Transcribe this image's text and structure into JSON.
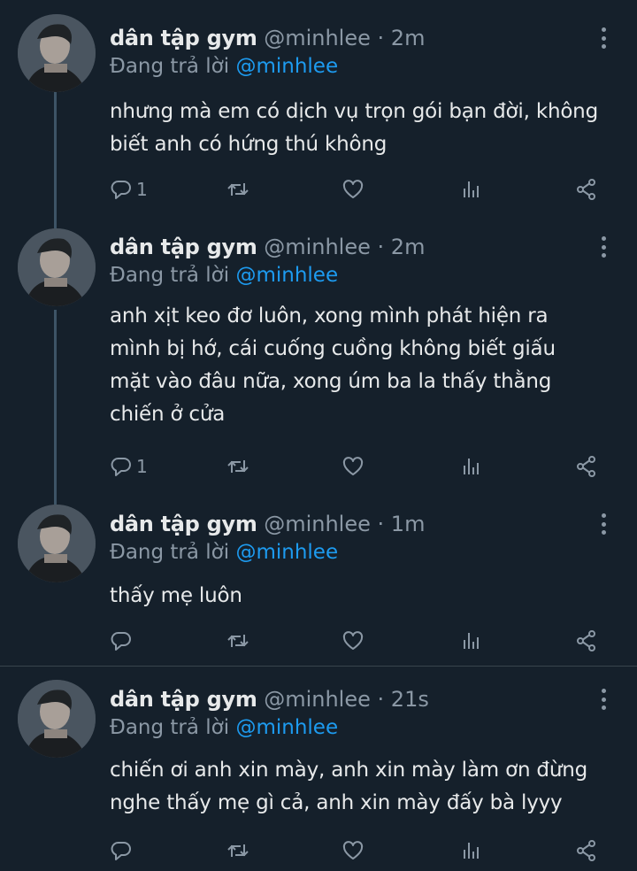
{
  "tweets": [
    {
      "display_name": "dân tập gym",
      "handle": "@minhlee",
      "separator": "·",
      "time": "2m",
      "reply_prefix": "Đang trả lời",
      "reply_to": "@minhlee",
      "text": "nhưng mà em có dịch vụ trọn gói bạn đời, không\nbiết anh có hứng thú không",
      "reply_count": "1"
    },
    {
      "display_name": "dân tập gym",
      "handle": "@minhlee",
      "separator": "·",
      "time": "2m",
      "reply_prefix": "Đang trả lời",
      "reply_to": "@minhlee",
      "text": "anh xịt keo đơ luôn, xong mình phát hiện ra\nmình bị hớ, cái cuống cuồng không biết giấu\nmặt vào đâu nữa, xong úm ba la thấy thằng\nchiến ở cửa",
      "reply_count": "1"
    },
    {
      "display_name": "dân tập gym",
      "handle": "@minhlee",
      "separator": "·",
      "time": "1m",
      "reply_prefix": "Đang trả lời",
      "reply_to": "@minhlee",
      "text": "thấy mẹ luôn",
      "reply_count": ""
    },
    {
      "display_name": "dân tập gym",
      "handle": "@minhlee",
      "separator": "·",
      "time": "21s",
      "reply_prefix": "Đang trả lời",
      "reply_to": "@minhlee",
      "text": "chiến ơi anh xin mày, anh xin mày làm ơn đừng\nnghe thấy mẹ gì cả, anh xin mày đấy bà lyyy",
      "reply_count": ""
    }
  ],
  "icons": {
    "reply": "reply-icon",
    "retweet": "retweet-icon",
    "like": "heart-icon",
    "views": "analytics-icon",
    "share": "share-icon",
    "more": "more-vertical-icon"
  },
  "colors": {
    "background": "#15202b",
    "text": "#e7e9ea",
    "muted": "#8b98a5",
    "link": "#1d9bf0",
    "thread_line": "#3d5466",
    "divider": "#38444d"
  }
}
